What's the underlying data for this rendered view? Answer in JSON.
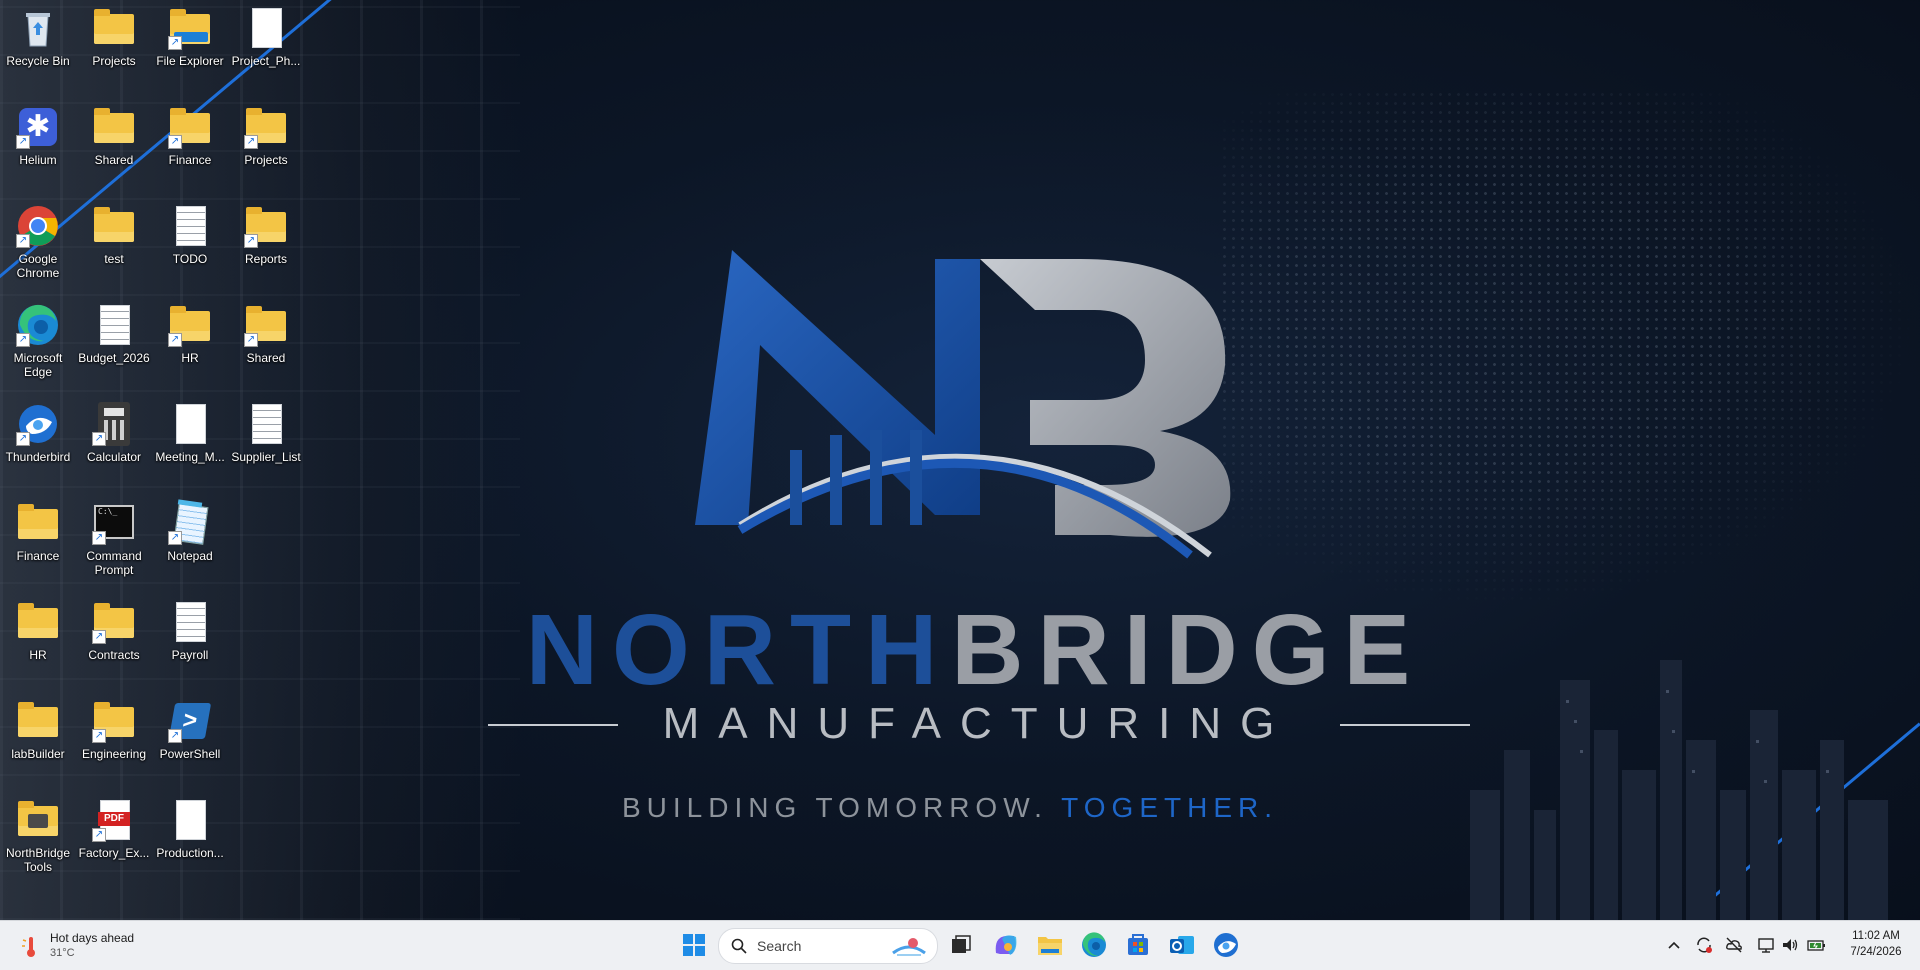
{
  "brand": {
    "north": "NORTH",
    "bridge": "BRIDGE",
    "manufacturing": "MANUFACTURING",
    "tagline_main": "BUILDING TOMORROW. ",
    "tagline_accent": "TOGETHER",
    "tagline_end": "."
  },
  "desktop_icons": [
    {
      "label": "Recycle Bin",
      "icon": "recycle-bin-icon"
    },
    {
      "label": "Projects",
      "icon": "folder-icon"
    },
    {
      "label": "File Explorer",
      "icon": "file-explorer-icon"
    },
    {
      "label": "Project_Ph...",
      "icon": "document-icon"
    },
    {
      "label": "Helium",
      "icon": "helium-icon"
    },
    {
      "label": "Shared",
      "icon": "folder-icon"
    },
    {
      "label": "Finance",
      "icon": "folder-shortcut-icon"
    },
    {
      "label": "Projects",
      "icon": "folder-shortcut-icon"
    },
    {
      "label": "Google Chrome",
      "icon": "chrome-icon"
    },
    {
      "label": "test",
      "icon": "folder-icon"
    },
    {
      "label": "TODO",
      "icon": "text-document-icon"
    },
    {
      "label": "Reports",
      "icon": "folder-shortcut-icon"
    },
    {
      "label": "Microsoft Edge",
      "icon": "edge-icon"
    },
    {
      "label": "Budget_2026",
      "icon": "text-document-icon"
    },
    {
      "label": "HR",
      "icon": "folder-shortcut-icon"
    },
    {
      "label": "Shared",
      "icon": "folder-shortcut-icon"
    },
    {
      "label": "Thunderbird",
      "icon": "thunderbird-icon"
    },
    {
      "label": "Calculator",
      "icon": "calculator-icon"
    },
    {
      "label": "Meeting_M...",
      "icon": "document-icon"
    },
    {
      "label": "Supplier_List",
      "icon": "text-document-icon"
    },
    {
      "label": "Finance",
      "icon": "folder-icon"
    },
    {
      "label": "Command Prompt",
      "icon": "command-prompt-icon"
    },
    {
      "label": "Notepad",
      "icon": "notepad-icon"
    },
    {
      "label": "HR",
      "icon": "folder-icon"
    },
    {
      "label": "Contracts",
      "icon": "folder-shortcut-icon"
    },
    {
      "label": "Payroll",
      "icon": "text-document-icon"
    },
    {
      "label": "labBuilder",
      "icon": "folder-icon"
    },
    {
      "label": "Engineering",
      "icon": "folder-shortcut-icon"
    },
    {
      "label": "PowerShell",
      "icon": "powershell-icon"
    },
    {
      "label": "NorthBridge Tools",
      "icon": "folder-tools-icon"
    },
    {
      "label": "Factory_Ex...",
      "icon": "pdf-icon"
    },
    {
      "label": "Production...",
      "icon": "document-icon"
    }
  ],
  "taskbar": {
    "weather_title": "Hot days ahead",
    "weather_temp": "31°C",
    "search_placeholder": "Search",
    "pinned": [
      "start-icon",
      "task-view-icon",
      "copilot-icon",
      "file-explorer-icon",
      "edge-icon",
      "store-icon",
      "outlook-icon",
      "thunderbird-icon"
    ],
    "clock_time": "11:02 AM",
    "clock_date": "7/24/2026"
  },
  "colors": {
    "accent_blue": "#1e66c8",
    "folder_yellow": "#f3c545",
    "taskbar_bg": "#eef0f3"
  }
}
